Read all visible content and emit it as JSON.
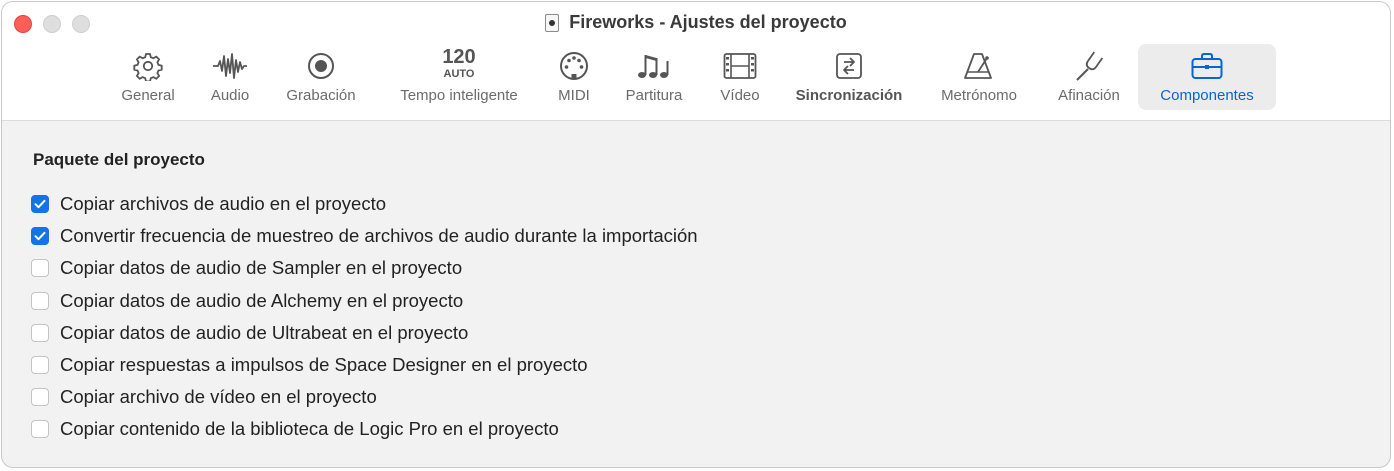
{
  "window": {
    "title": "Fireworks - Ajustes del proyecto"
  },
  "toolbar": {
    "tabs": [
      {
        "label": "General",
        "icon": "gear-icon"
      },
      {
        "label": "Audio",
        "icon": "waveform-icon"
      },
      {
        "label": "Grabación",
        "icon": "record-icon"
      },
      {
        "label": "Tempo inteligente",
        "icon": "tempo-icon",
        "icon_top": "120",
        "icon_bottom": "AUTO"
      },
      {
        "label": "MIDI",
        "icon": "midi-connector-icon"
      },
      {
        "label": "Partitura",
        "icon": "music-notes-icon"
      },
      {
        "label": "Vídeo",
        "icon": "film-strip-icon"
      },
      {
        "label": "Sincronización",
        "icon": "sync-arrows-icon"
      },
      {
        "label": "Metrónomo",
        "icon": "metronome-icon"
      },
      {
        "label": "Afinación",
        "icon": "tuning-fork-icon"
      },
      {
        "label": "Componentes",
        "icon": "briefcase-icon",
        "selected": true
      }
    ]
  },
  "section": {
    "title": "Paquete del proyecto",
    "options": [
      {
        "label": "Copiar archivos de audio en el proyecto",
        "checked": true
      },
      {
        "label": "Convertir frecuencia de muestreo de archivos de audio durante la importación",
        "checked": true
      },
      {
        "label": "Copiar datos de audio de Sampler en el proyecto",
        "checked": false
      },
      {
        "label": "Copiar datos de audio de Alchemy en el proyecto",
        "checked": false
      },
      {
        "label": "Copiar datos de audio de Ultrabeat en el proyecto",
        "checked": false
      },
      {
        "label": "Copiar respuestas a impulsos de Space Designer en el proyecto",
        "checked": false
      },
      {
        "label": "Copiar archivo de vídeo en el proyecto",
        "checked": false
      },
      {
        "label": "Copiar contenido de la biblioteca de Logic Pro en el proyecto",
        "checked": false
      }
    ]
  },
  "colors": {
    "accent": "#1473e6",
    "selected_label": "#0a64d6",
    "close_button": "#ff5f57"
  }
}
